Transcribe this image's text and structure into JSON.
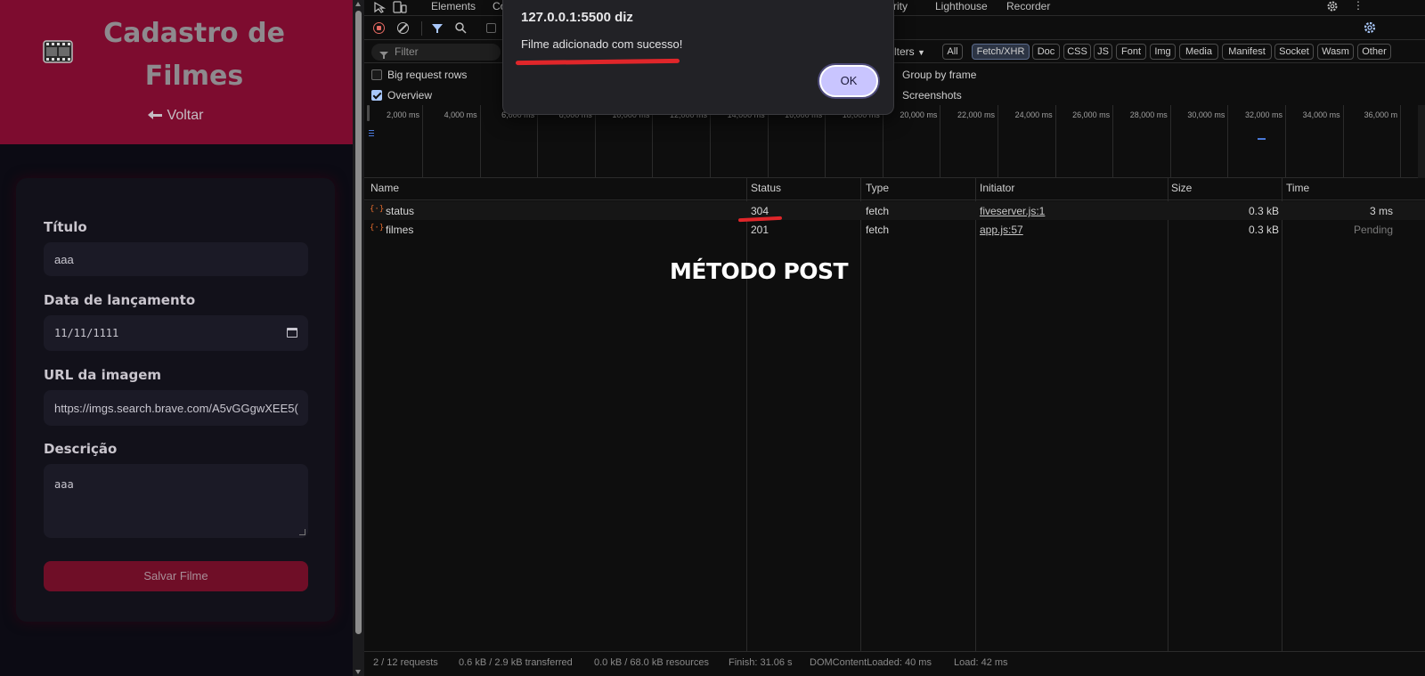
{
  "app": {
    "title": "Cadastro de Filmes",
    "back_label": "Voltar",
    "form": {
      "title_label": "Título",
      "title_value": "aaa",
      "date_label": "Data de lançamento",
      "date_value": "11/11/1111",
      "url_label": "URL da imagem",
      "url_value": "https://imgs.search.brave.com/A5vGGgwXEE5(",
      "description_label": "Descrição",
      "description_value": "aaa",
      "save_label": "Salvar Filme"
    }
  },
  "devtools": {
    "tabs": [
      "Elements",
      "Co",
      "rity",
      "Lighthouse",
      "Recorder"
    ],
    "filter_placeholder": "Filter",
    "filters_label": "lters",
    "type_filters": [
      "All",
      "Fetch/XHR",
      "Doc",
      "CSS",
      "JS",
      "Font",
      "Img",
      "Media",
      "Manifest",
      "Socket",
      "Wasm",
      "Other"
    ],
    "active_type_filter": "Fetch/XHR",
    "options": {
      "big_request_rows": "Big request rows",
      "overview": "Overview",
      "group_by_frame": "Group by frame",
      "screenshots": "Screenshots"
    },
    "timeline_ticks": [
      "2,000 ms",
      "4,000 ms",
      "6,000 ms",
      "8,000 ms",
      "10,000 ms",
      "12,000 ms",
      "14,000 ms",
      "16,000 ms",
      "18,000 ms",
      "20,000 ms",
      "22,000 ms",
      "24,000 ms",
      "26,000 ms",
      "28,000 ms",
      "30,000 ms",
      "32,000 ms",
      "34,000 ms",
      "36,000 m"
    ],
    "columns": [
      "Name",
      "Status",
      "Type",
      "Initiator",
      "Size",
      "Time"
    ],
    "requests": [
      {
        "name": "status",
        "status": "304",
        "type": "fetch",
        "initiator": "fiveserver.js:1",
        "size": "0.3 kB",
        "time": "3 ms"
      },
      {
        "name": "filmes",
        "status": "201",
        "type": "fetch",
        "initiator": "app.js:57",
        "size": "0.3 kB",
        "time": "Pending"
      }
    ],
    "statusbar": {
      "requests": "2 / 12 requests",
      "transferred": "0.6 kB / 2.9 kB transferred",
      "resources": "0.0 kB / 68.0 kB resources",
      "finish": "Finish: 31.06 s",
      "dcl": "DOMContentLoaded: 40 ms",
      "load": "Load: 42 ms"
    }
  },
  "annotation": "MÉTODO POST",
  "dialog": {
    "title": "127.0.0.1:5500 diz",
    "message": "Filme adicionado com sucesso!",
    "ok_label": "OK"
  },
  "colors": {
    "header_bg": "#7d0c2f",
    "save_button": "#6f0e27",
    "annotation_red": "#e0262a",
    "ok_button": "#c9c5ff"
  }
}
